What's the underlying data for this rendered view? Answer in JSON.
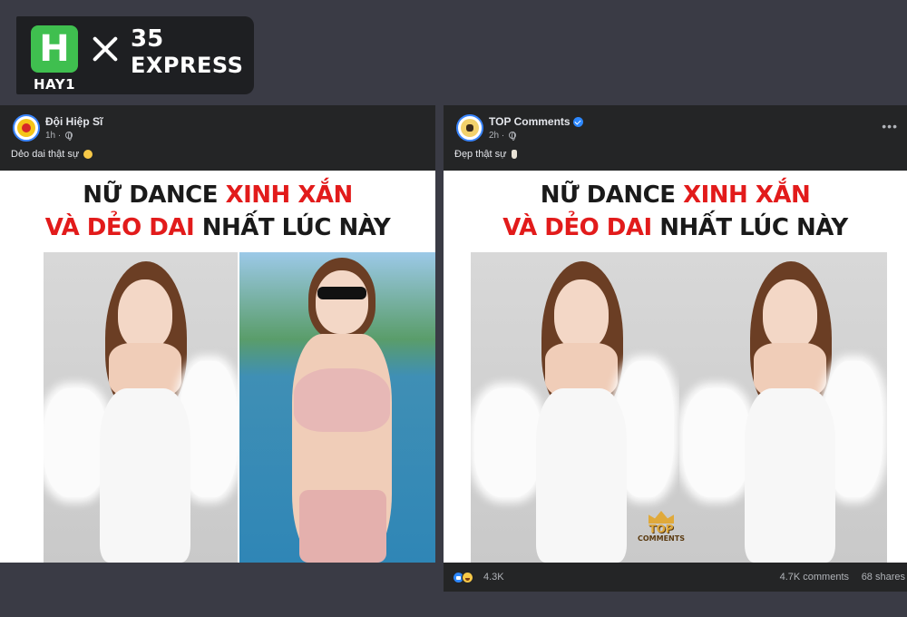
{
  "brand": {
    "logo_letter": "H",
    "name": "HAY1",
    "partner_number": "35",
    "partner_name": "EXPRESS"
  },
  "posts": [
    {
      "page_name": "Đội Hiệp Sĩ",
      "time": "1h ·",
      "caption": "Dẻo dai thật sự",
      "headline_line1_black": "NỮ DANCE ",
      "headline_line1_red": "XINH XẮN",
      "headline_line2_red": "VÀ DẺO DAI ",
      "headline_line2_black": "NHẤT LÚC NÀY"
    },
    {
      "page_name": "TOP Comments",
      "time": "2h ·",
      "caption": "Đẹp thật sự",
      "headline_line1_black": "NỮ DANCE ",
      "headline_line1_red": "XINH XẮN",
      "headline_line2_red": "VÀ DẺO DAI ",
      "headline_line2_black": "NHẤT LÚC NÀY",
      "watermark_line1": "TOP",
      "watermark_line2": "COMMENTS",
      "more_label": "•••",
      "reactions_count": "4.3K",
      "comments_count": "4.7K comments",
      "shares_count": "68 shares"
    }
  ],
  "colors": {
    "background": "#3a3b45",
    "post_bg": "#242526",
    "headline_red": "#e21b1b",
    "brand_green": "#3fbf4f",
    "verified_blue": "#2d88ff"
  }
}
